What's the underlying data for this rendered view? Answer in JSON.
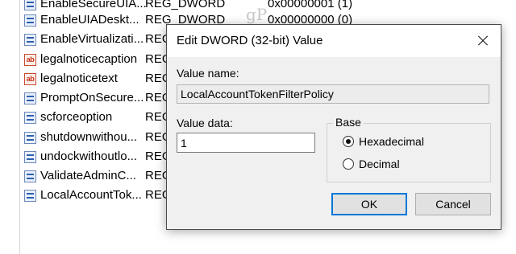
{
  "watermark": "gP",
  "registry_rows": [
    {
      "icon": "binary-value-icon",
      "name": "EnableSecureUIA...",
      "type": "REG_DWORD",
      "data": "0x00000001 (1)"
    },
    {
      "icon": "binary-value-icon",
      "name": "EnableUIADeskt...",
      "type": "REG_DWORD",
      "data": "0x00000000 (0)"
    },
    {
      "icon": "binary-value-icon",
      "name": "EnableVirtualizati...",
      "type": "REG",
      "data": ""
    },
    {
      "icon": "string-value-icon",
      "name": "legalnoticecaption",
      "type": "REG",
      "data": ""
    },
    {
      "icon": "string-value-icon",
      "name": "legalnoticetext",
      "type": "REG",
      "data": ""
    },
    {
      "icon": "binary-value-icon",
      "name": "PromptOnSecure...",
      "type": "REG",
      "data": ""
    },
    {
      "icon": "binary-value-icon",
      "name": "scforceoption",
      "type": "REG",
      "data": ""
    },
    {
      "icon": "binary-value-icon",
      "name": "shutdownwithou...",
      "type": "REG",
      "data": ""
    },
    {
      "icon": "binary-value-icon",
      "name": "undockwithoutlo...",
      "type": "REG",
      "data": ""
    },
    {
      "icon": "binary-value-icon",
      "name": "ValidateAdminC...",
      "type": "REG",
      "data": ""
    },
    {
      "icon": "binary-value-icon",
      "name": "LocalAccountTok...",
      "type": "REG",
      "data": ""
    }
  ],
  "string_icon_glyph": "ab",
  "dialog": {
    "title": "Edit DWORD (32-bit) Value",
    "value_name_label": "Value name:",
    "value_name": "LocalAccountTokenFilterPolicy",
    "value_data_label": "Value data:",
    "value_data": "1",
    "base_label": "Base",
    "base_options": [
      {
        "label": "Hexadecimal",
        "selected": true
      },
      {
        "label": "Decimal",
        "selected": false
      }
    ],
    "ok_label": "OK",
    "cancel_label": "Cancel"
  },
  "colors": {
    "accent": "#0078d7",
    "dialog_bg": "#f0f0f0"
  }
}
